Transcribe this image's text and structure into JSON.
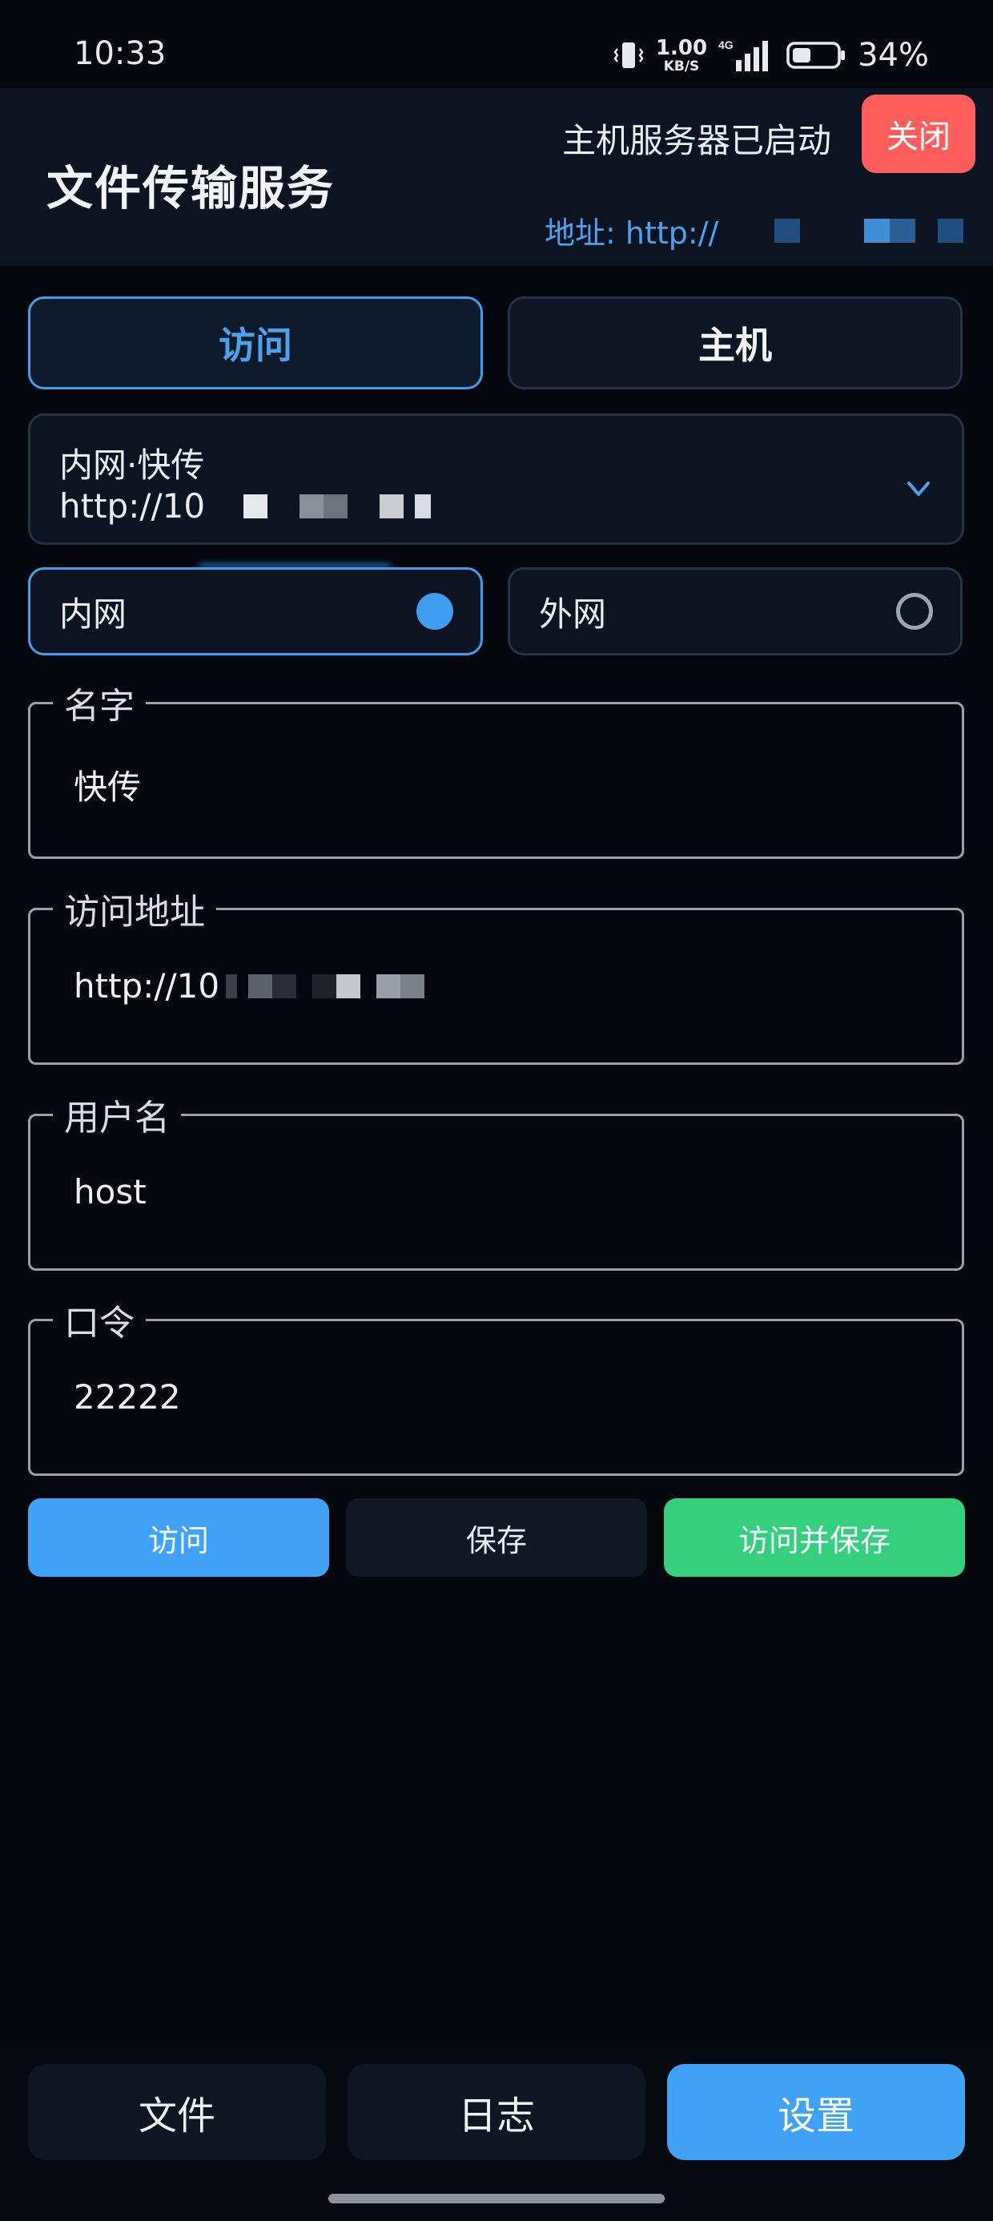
{
  "status_bar": {
    "time": "10:33",
    "speed_value": "1.00",
    "speed_unit": "KB/S",
    "network": "4G",
    "battery_percent": "34%"
  },
  "header": {
    "title": "文件传输服务",
    "server_status": "主机服务器已启动",
    "close_label": "关闭",
    "address": "地址: http://"
  },
  "tabs": {
    "visit": "访问",
    "host": "主机"
  },
  "saved_entry": {
    "name": "内网·快传",
    "url": "http://10"
  },
  "network": {
    "lan_label": "内网",
    "wan_label": "外网",
    "selected": "lan"
  },
  "fields": {
    "name": {
      "label": "名字",
      "value": "快传"
    },
    "url": {
      "label": "访问地址",
      "value": "http://10"
    },
    "username": {
      "label": "用户名",
      "value": "host"
    },
    "password": {
      "label": "口令",
      "value": "22222"
    }
  },
  "actions": {
    "visit": "访问",
    "save": "保存",
    "visit_and_save": "访问并保存"
  },
  "bottom_nav": {
    "files": "文件",
    "logs": "日志",
    "settings": "设置"
  },
  "colors": {
    "accent_blue": "#3fa2f6",
    "success_green": "#34d07e",
    "danger_red": "#ff5c5c"
  }
}
